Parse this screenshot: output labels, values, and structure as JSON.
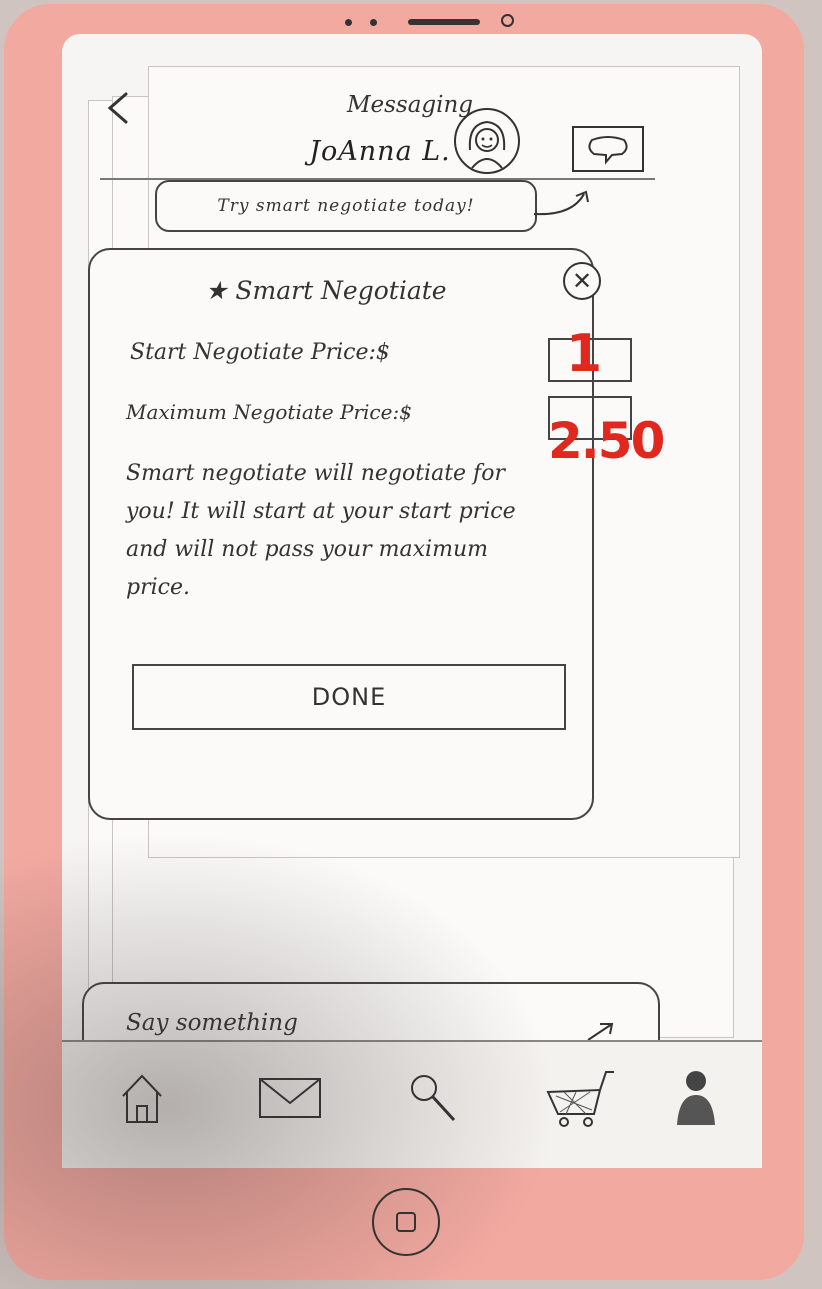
{
  "header": {
    "back_icon": "chevron-left-icon",
    "title": "Messaging",
    "contact_name": "JoAnna L.",
    "avatar_icon": "avatar-sketch",
    "chat_icon": "speech-bubble-icon"
  },
  "promo": {
    "text": "Try smart negotiate today!"
  },
  "smart_negotiate": {
    "title": "Smart Negotiate",
    "title_icon": "star-icon",
    "close_icon": "close-icon",
    "start_label": "Start Negotiate Price:$",
    "start_value": "1",
    "max_label": "Maximum Negotiate Price:$",
    "max_value": "2.50",
    "description": "Smart negotiate will negotiate for you! It will start at your start price and will not pass your maximum price.",
    "done_label": "DONE"
  },
  "composer": {
    "placeholder": "Say something",
    "send_icon": "send-icon"
  },
  "tabbar": {
    "items": [
      {
        "icon": "home-icon"
      },
      {
        "icon": "mail-icon"
      },
      {
        "icon": "search-icon"
      },
      {
        "icon": "cart-icon"
      },
      {
        "icon": "profile-icon"
      }
    ]
  },
  "colors": {
    "phone_body": "#f2a9a0",
    "ink": "#333333",
    "value_ink": "#e0281e",
    "paper": "#fbfaf8"
  }
}
